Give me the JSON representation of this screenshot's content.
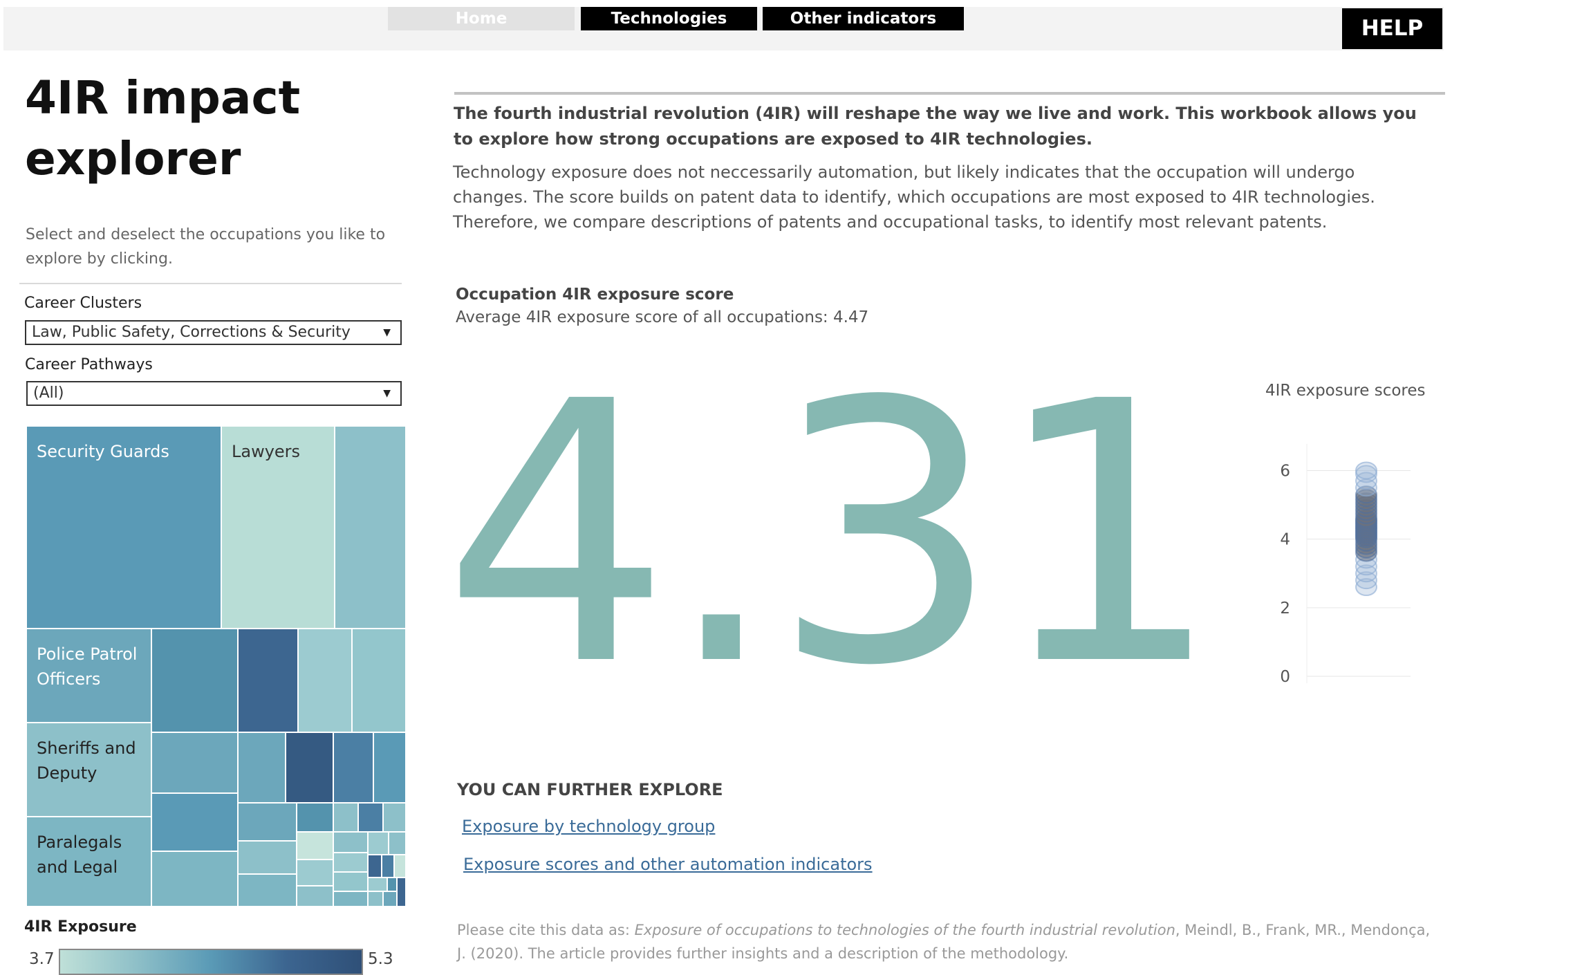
{
  "nav": {
    "home": "Home",
    "technologies": "Technologies",
    "other_indicators": "Other indicators",
    "help": "HELP"
  },
  "sidebar": {
    "title_line1": "4IR impact",
    "title_line2": "explorer",
    "subtitle": "Select and deselect the occupations you like to explore by clicking.",
    "career_clusters_label": "Career Clusters",
    "career_clusters_value": "Law, Public Safety, Corrections & Security",
    "career_pathways_label": "Career Pathways",
    "career_pathways_value": "(All)",
    "treemap_labels": {
      "security_guards": "Security Guards",
      "lawyers": "Lawyers",
      "police": "Police Patrol Officers",
      "sheriffs": "Sheriffs and Deputy",
      "paralegals": "Paralegals and Legal"
    },
    "legend": {
      "label": "4IR Exposure",
      "min": "3.7",
      "max": "5.3"
    }
  },
  "main": {
    "intro_bold": "The fourth industrial revolution (4IR) will reshape the way we live and work. This workbook allows you to explore how strong occupations are exposed to 4IR technologies.",
    "intro_body": "Technology exposure does not neccessarily automation, but likely indicates that the occupation will undergo changes. The score builds on patent data to identify, which occupations are most exposed to 4IR technologies. Therefore, we compare descriptions of patents and occupational tasks, to identify most relevant patents.",
    "score_title": "Occupation 4IR exposure score",
    "score_avg": "Average 4IR exposure score of all occupations: 4.47",
    "score_value": "4.31",
    "explore_title": "YOU CAN FURTHER EXPLORE",
    "link1": "Exposure by technology group",
    "link2": "Exposure scores and other automation indicators",
    "cite_prefix": "Please cite this data as: ",
    "cite_title": "Exposure of occupations to technologies of the fourth industrial revolution",
    "cite_suffix": ", Meindl, B., Frank, MR., Mendonça, J. (2020). The article provides further insights and a description of the methodology."
  },
  "colors": {
    "score": "#86b8b2",
    "nav_active": "#000000",
    "link": "#3a6b98"
  },
  "chart_data": {
    "type": "scatter",
    "title": "4IR exposure scores",
    "ylim": [
      0,
      6
    ],
    "yticks": [
      "0",
      "2",
      "4",
      "6"
    ],
    "points": [
      2.6,
      2.8,
      3.0,
      3.2,
      3.4,
      3.6,
      3.7,
      3.8,
      3.9,
      4.0,
      4.05,
      4.1,
      4.15,
      4.2,
      4.25,
      4.3,
      4.35,
      4.4,
      4.45,
      4.5,
      4.55,
      4.6,
      4.7,
      4.8,
      4.9,
      5.0,
      5.1,
      5.2,
      5.3,
      5.5,
      5.7,
      5.9,
      6.0
    ]
  }
}
